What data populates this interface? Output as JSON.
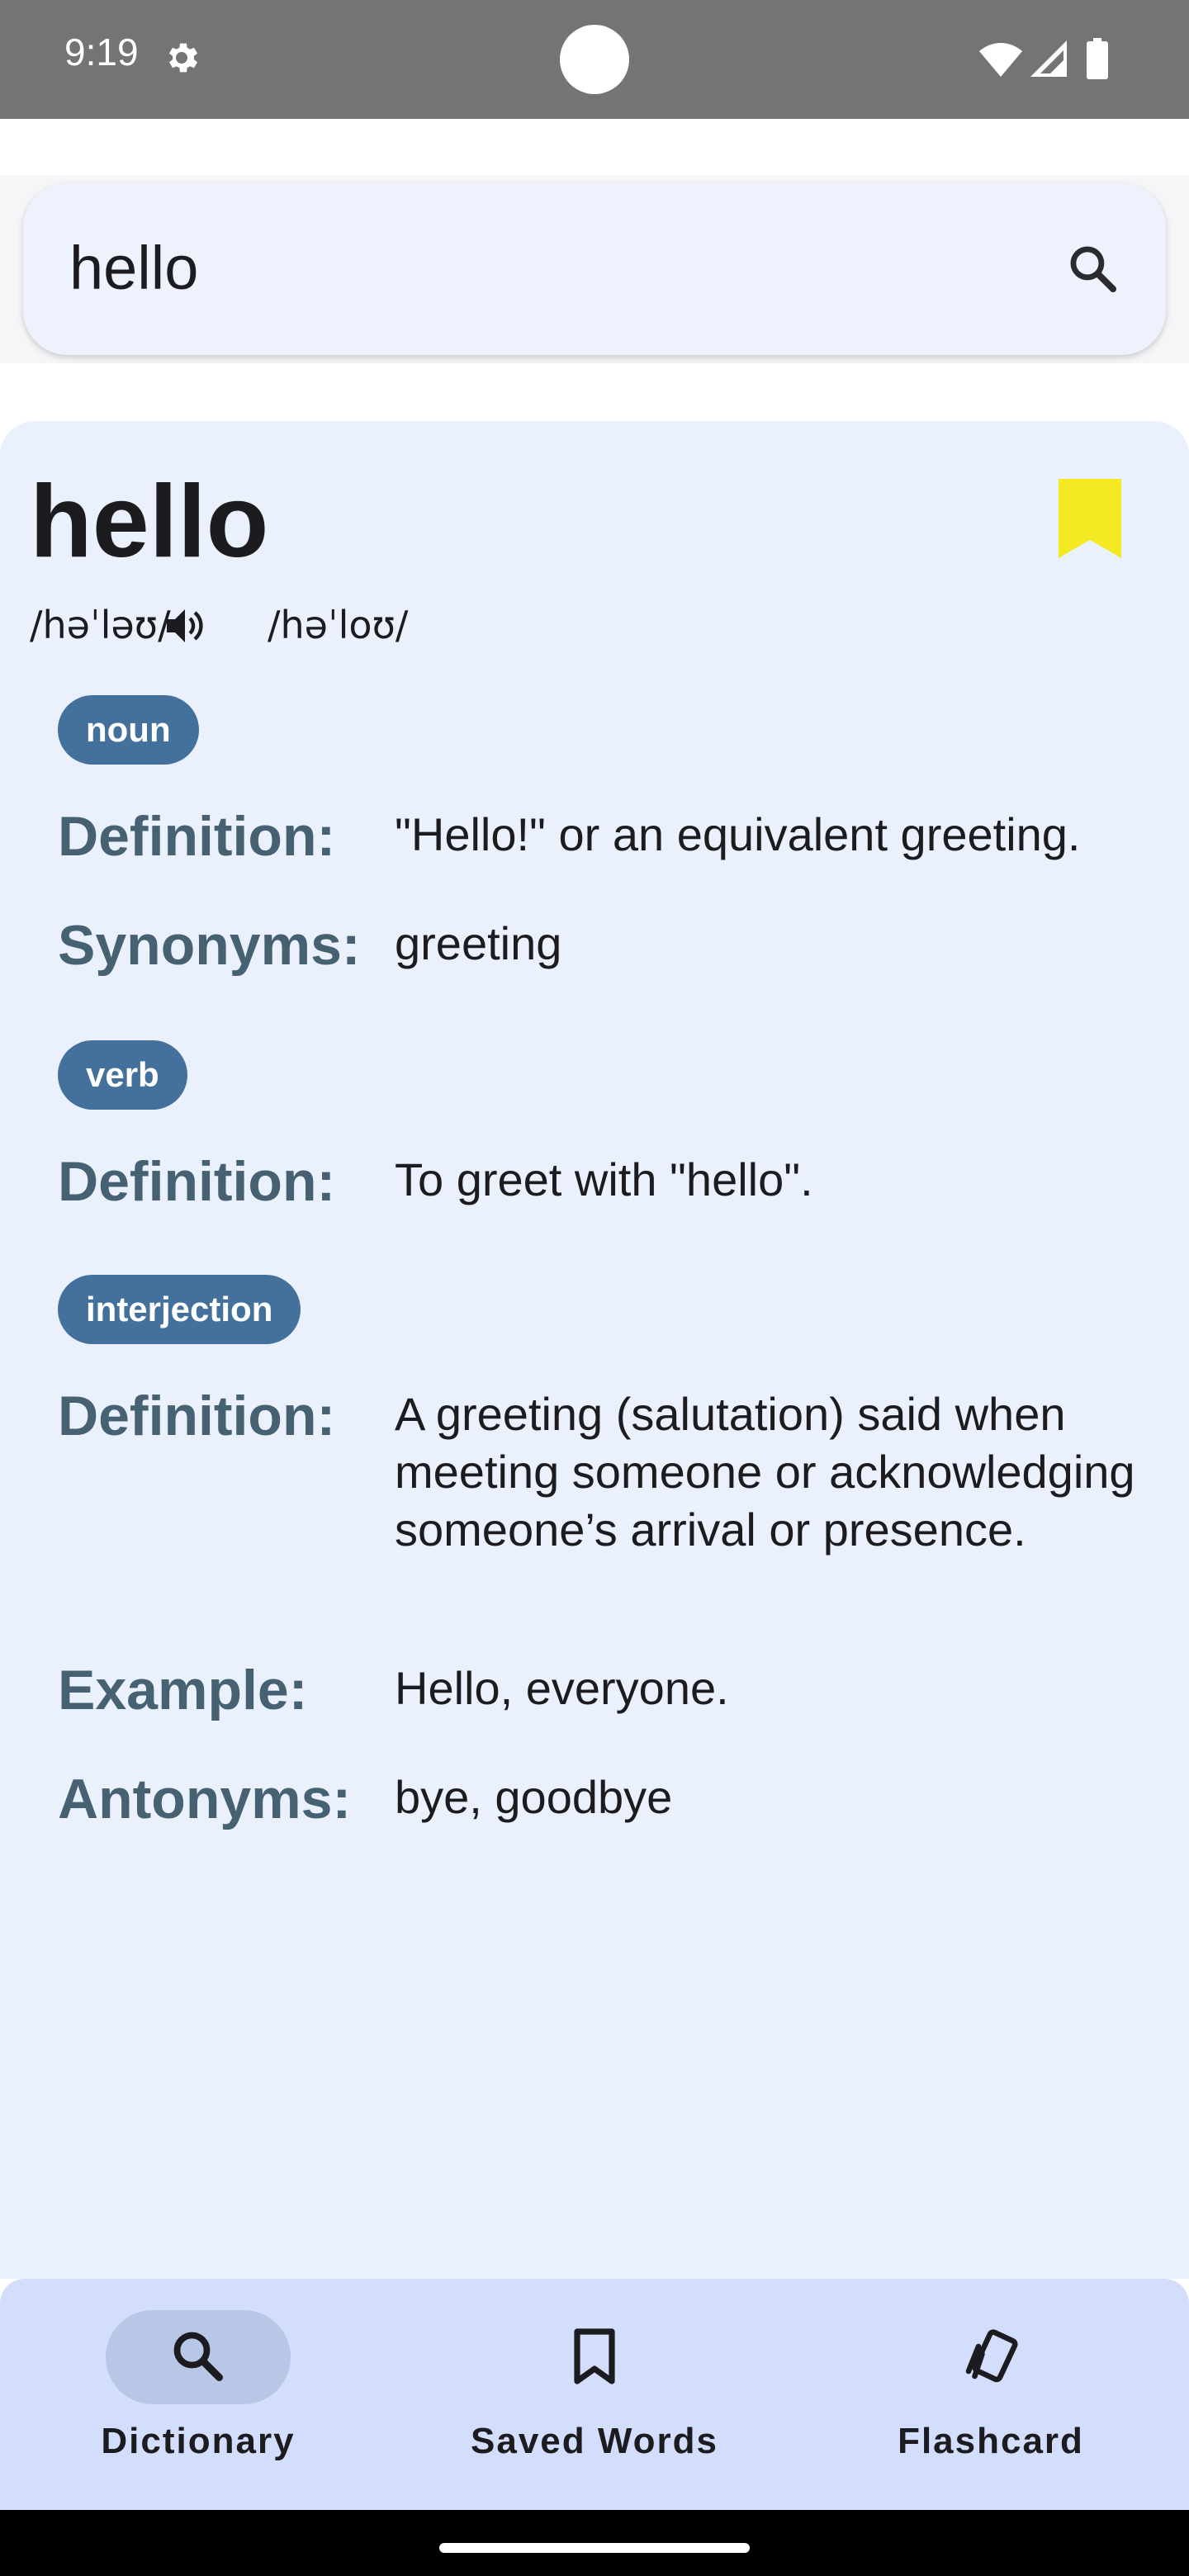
{
  "status_bar": {
    "time": "9:19",
    "icons": [
      "gear-icon",
      "wifi-icon",
      "signal-icon",
      "battery-icon"
    ]
  },
  "search": {
    "value": "hello",
    "icon": "search-icon"
  },
  "entry": {
    "word": "hello",
    "saved": true,
    "bookmark_color": "#f4ea24",
    "phonetics": [
      "/həˈləʊ/",
      "/həˈloʊ/"
    ],
    "meanings": [
      {
        "part_of_speech": "noun",
        "definition_label": "Definition:",
        "definition": "\"Hello!\" or an equivalent greeting.",
        "synonyms_label": "Synonyms:",
        "synonyms": "greeting"
      },
      {
        "part_of_speech": "verb",
        "definition_label": "Definition:",
        "definition": "To greet with \"hello\"."
      },
      {
        "part_of_speech": "interjection",
        "definition_label": "Definition:",
        "definition": "A greeting (salutation) said when meeting someone or acknowledging someone’s arrival or presence.",
        "example_label": "Example:",
        "example": "Hello, everyone.",
        "antonyms_label": "Antonyms:",
        "antonyms": "bye, goodbye"
      }
    ]
  },
  "bottom_nav": {
    "items": [
      {
        "label": "Dictionary",
        "icon": "search-icon",
        "active": true
      },
      {
        "label": "Saved Words",
        "icon": "bookmark-outline-icon",
        "active": false
      },
      {
        "label": "Flashcard",
        "icon": "flashcards-icon",
        "active": false
      }
    ]
  },
  "colors": {
    "card_background": "#eaf1fd",
    "chip_background": "#44719b",
    "label_color": "#456172",
    "nav_background": "#d3defc",
    "nav_active_pill": "#b8c7e6"
  }
}
